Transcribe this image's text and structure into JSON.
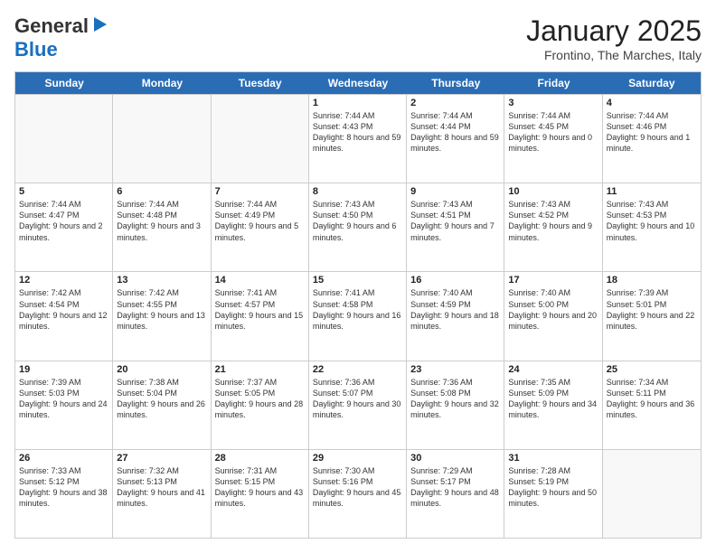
{
  "header": {
    "logo_general": "General",
    "logo_blue": "Blue",
    "month_title": "January 2025",
    "location": "Frontino, The Marches, Italy"
  },
  "weekdays": [
    "Sunday",
    "Monday",
    "Tuesday",
    "Wednesday",
    "Thursday",
    "Friday",
    "Saturday"
  ],
  "rows": [
    [
      {
        "day": "",
        "sunrise": "",
        "sunset": "",
        "daylight": ""
      },
      {
        "day": "",
        "sunrise": "",
        "sunset": "",
        "daylight": ""
      },
      {
        "day": "",
        "sunrise": "",
        "sunset": "",
        "daylight": ""
      },
      {
        "day": "1",
        "sunrise": "Sunrise: 7:44 AM",
        "sunset": "Sunset: 4:43 PM",
        "daylight": "Daylight: 8 hours and 59 minutes."
      },
      {
        "day": "2",
        "sunrise": "Sunrise: 7:44 AM",
        "sunset": "Sunset: 4:44 PM",
        "daylight": "Daylight: 8 hours and 59 minutes."
      },
      {
        "day": "3",
        "sunrise": "Sunrise: 7:44 AM",
        "sunset": "Sunset: 4:45 PM",
        "daylight": "Daylight: 9 hours and 0 minutes."
      },
      {
        "day": "4",
        "sunrise": "Sunrise: 7:44 AM",
        "sunset": "Sunset: 4:46 PM",
        "daylight": "Daylight: 9 hours and 1 minute."
      }
    ],
    [
      {
        "day": "5",
        "sunrise": "Sunrise: 7:44 AM",
        "sunset": "Sunset: 4:47 PM",
        "daylight": "Daylight: 9 hours and 2 minutes."
      },
      {
        "day": "6",
        "sunrise": "Sunrise: 7:44 AM",
        "sunset": "Sunset: 4:48 PM",
        "daylight": "Daylight: 9 hours and 3 minutes."
      },
      {
        "day": "7",
        "sunrise": "Sunrise: 7:44 AM",
        "sunset": "Sunset: 4:49 PM",
        "daylight": "Daylight: 9 hours and 5 minutes."
      },
      {
        "day": "8",
        "sunrise": "Sunrise: 7:43 AM",
        "sunset": "Sunset: 4:50 PM",
        "daylight": "Daylight: 9 hours and 6 minutes."
      },
      {
        "day": "9",
        "sunrise": "Sunrise: 7:43 AM",
        "sunset": "Sunset: 4:51 PM",
        "daylight": "Daylight: 9 hours and 7 minutes."
      },
      {
        "day": "10",
        "sunrise": "Sunrise: 7:43 AM",
        "sunset": "Sunset: 4:52 PM",
        "daylight": "Daylight: 9 hours and 9 minutes."
      },
      {
        "day": "11",
        "sunrise": "Sunrise: 7:43 AM",
        "sunset": "Sunset: 4:53 PM",
        "daylight": "Daylight: 9 hours and 10 minutes."
      }
    ],
    [
      {
        "day": "12",
        "sunrise": "Sunrise: 7:42 AM",
        "sunset": "Sunset: 4:54 PM",
        "daylight": "Daylight: 9 hours and 12 minutes."
      },
      {
        "day": "13",
        "sunrise": "Sunrise: 7:42 AM",
        "sunset": "Sunset: 4:55 PM",
        "daylight": "Daylight: 9 hours and 13 minutes."
      },
      {
        "day": "14",
        "sunrise": "Sunrise: 7:41 AM",
        "sunset": "Sunset: 4:57 PM",
        "daylight": "Daylight: 9 hours and 15 minutes."
      },
      {
        "day": "15",
        "sunrise": "Sunrise: 7:41 AM",
        "sunset": "Sunset: 4:58 PM",
        "daylight": "Daylight: 9 hours and 16 minutes."
      },
      {
        "day": "16",
        "sunrise": "Sunrise: 7:40 AM",
        "sunset": "Sunset: 4:59 PM",
        "daylight": "Daylight: 9 hours and 18 minutes."
      },
      {
        "day": "17",
        "sunrise": "Sunrise: 7:40 AM",
        "sunset": "Sunset: 5:00 PM",
        "daylight": "Daylight: 9 hours and 20 minutes."
      },
      {
        "day": "18",
        "sunrise": "Sunrise: 7:39 AM",
        "sunset": "Sunset: 5:01 PM",
        "daylight": "Daylight: 9 hours and 22 minutes."
      }
    ],
    [
      {
        "day": "19",
        "sunrise": "Sunrise: 7:39 AM",
        "sunset": "Sunset: 5:03 PM",
        "daylight": "Daylight: 9 hours and 24 minutes."
      },
      {
        "day": "20",
        "sunrise": "Sunrise: 7:38 AM",
        "sunset": "Sunset: 5:04 PM",
        "daylight": "Daylight: 9 hours and 26 minutes."
      },
      {
        "day": "21",
        "sunrise": "Sunrise: 7:37 AM",
        "sunset": "Sunset: 5:05 PM",
        "daylight": "Daylight: 9 hours and 28 minutes."
      },
      {
        "day": "22",
        "sunrise": "Sunrise: 7:36 AM",
        "sunset": "Sunset: 5:07 PM",
        "daylight": "Daylight: 9 hours and 30 minutes."
      },
      {
        "day": "23",
        "sunrise": "Sunrise: 7:36 AM",
        "sunset": "Sunset: 5:08 PM",
        "daylight": "Daylight: 9 hours and 32 minutes."
      },
      {
        "day": "24",
        "sunrise": "Sunrise: 7:35 AM",
        "sunset": "Sunset: 5:09 PM",
        "daylight": "Daylight: 9 hours and 34 minutes."
      },
      {
        "day": "25",
        "sunrise": "Sunrise: 7:34 AM",
        "sunset": "Sunset: 5:11 PM",
        "daylight": "Daylight: 9 hours and 36 minutes."
      }
    ],
    [
      {
        "day": "26",
        "sunrise": "Sunrise: 7:33 AM",
        "sunset": "Sunset: 5:12 PM",
        "daylight": "Daylight: 9 hours and 38 minutes."
      },
      {
        "day": "27",
        "sunrise": "Sunrise: 7:32 AM",
        "sunset": "Sunset: 5:13 PM",
        "daylight": "Daylight: 9 hours and 41 minutes."
      },
      {
        "day": "28",
        "sunrise": "Sunrise: 7:31 AM",
        "sunset": "Sunset: 5:15 PM",
        "daylight": "Daylight: 9 hours and 43 minutes."
      },
      {
        "day": "29",
        "sunrise": "Sunrise: 7:30 AM",
        "sunset": "Sunset: 5:16 PM",
        "daylight": "Daylight: 9 hours and 45 minutes."
      },
      {
        "day": "30",
        "sunrise": "Sunrise: 7:29 AM",
        "sunset": "Sunset: 5:17 PM",
        "daylight": "Daylight: 9 hours and 48 minutes."
      },
      {
        "day": "31",
        "sunrise": "Sunrise: 7:28 AM",
        "sunset": "Sunset: 5:19 PM",
        "daylight": "Daylight: 9 hours and 50 minutes."
      },
      {
        "day": "",
        "sunrise": "",
        "sunset": "",
        "daylight": ""
      }
    ]
  ]
}
